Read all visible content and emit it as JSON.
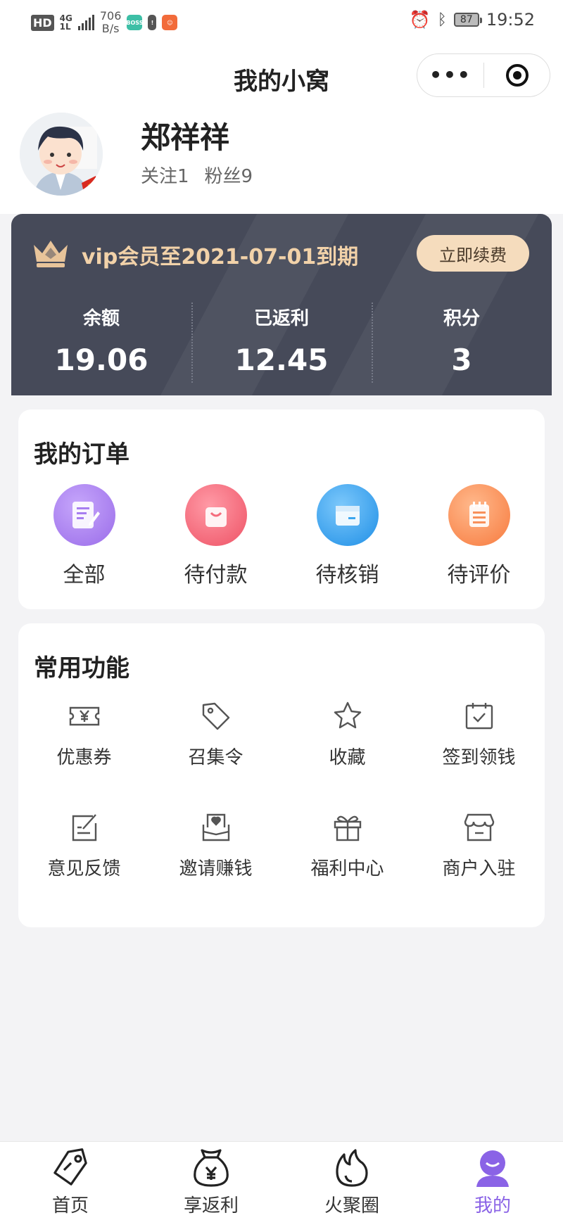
{
  "status_bar": {
    "hd": "HD",
    "net_top": "4G",
    "net_bottom": "1L",
    "speed_value": "706",
    "speed_unit": "B/s",
    "battery": "87",
    "time": "19:52"
  },
  "header": {
    "title": "我的小窝",
    "more_label": "•••"
  },
  "profile": {
    "name": "郑祥祥",
    "following": "关注1",
    "followers": "粉丝9"
  },
  "vip": {
    "status_text": "vip会员至2021-07-01到期",
    "renew_label": "立即续费",
    "stats": [
      {
        "label": "余额",
        "value": "19.06"
      },
      {
        "label": "已返利",
        "value": "12.45"
      },
      {
        "label": "积分",
        "value": "3"
      }
    ]
  },
  "orders": {
    "title": "我的订单",
    "items": [
      {
        "label": "全部",
        "icon": "edit-icon",
        "color": "#a77ef0"
      },
      {
        "label": "待付款",
        "icon": "shopping-bag-icon",
        "color": "#f56c7d"
      },
      {
        "label": "待核销",
        "icon": "box-icon",
        "color": "#3aa6ef"
      },
      {
        "label": "待评价",
        "icon": "notepad-icon",
        "color": "#f8905a"
      }
    ]
  },
  "functions": {
    "title": "常用功能",
    "items": [
      {
        "label": "优惠券",
        "icon": "coupon-icon"
      },
      {
        "label": "召集令",
        "icon": "tag-icon"
      },
      {
        "label": "收藏",
        "icon": "star-icon"
      },
      {
        "label": "签到领钱",
        "icon": "calendar-check-icon"
      },
      {
        "label": "意见反馈",
        "icon": "feedback-icon"
      },
      {
        "label": "邀请赚钱",
        "icon": "invite-mail-icon"
      },
      {
        "label": "福利中心",
        "icon": "gift-icon"
      },
      {
        "label": "商户入驻",
        "icon": "store-icon"
      }
    ]
  },
  "tabbar": {
    "items": [
      {
        "label": "首页",
        "icon": "tag-home-icon",
        "active": false
      },
      {
        "label": "享返利",
        "icon": "money-bag-icon",
        "active": false
      },
      {
        "label": "火聚圈",
        "icon": "flame-icon",
        "active": false
      },
      {
        "label": "我的",
        "icon": "user-icon",
        "active": true
      }
    ],
    "active_color": "#8a63e6"
  }
}
